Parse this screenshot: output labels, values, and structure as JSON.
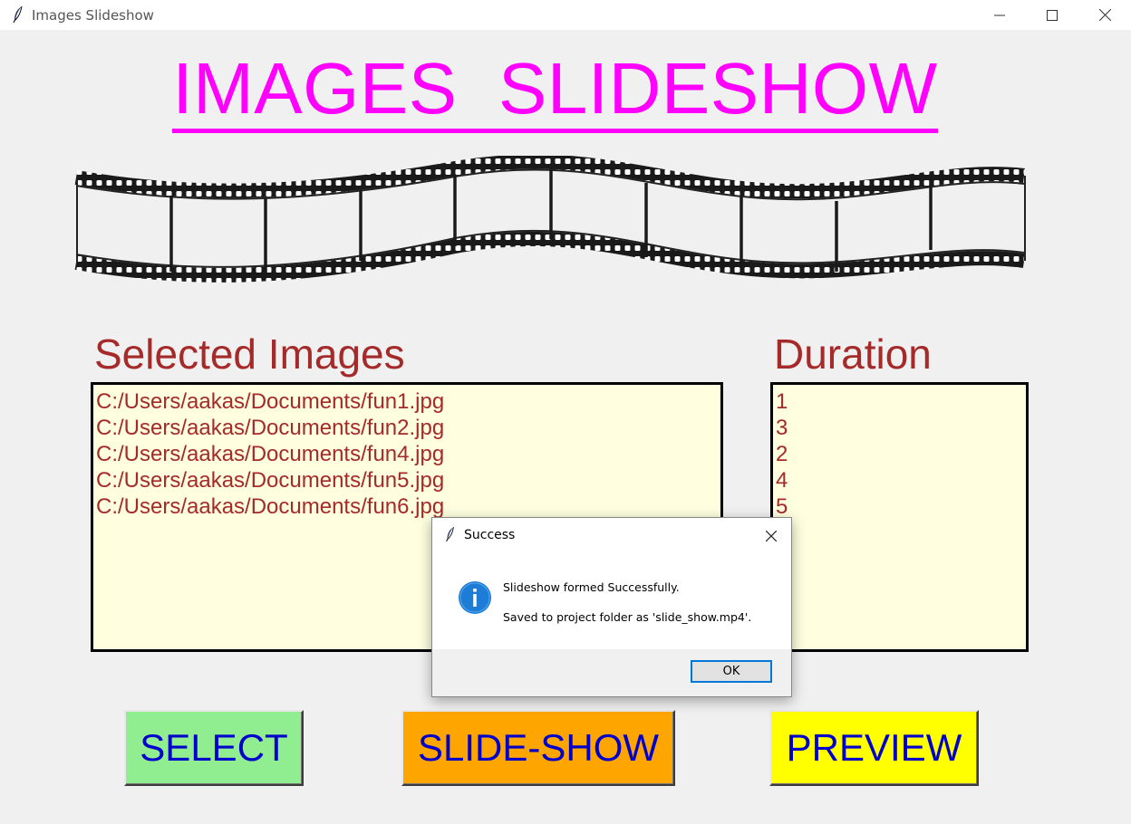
{
  "window": {
    "title": "Images Slideshow",
    "controls": [
      "minimize",
      "maximize",
      "close"
    ]
  },
  "header": {
    "title": "IMAGES  SLIDESHOW",
    "title_color": "#ff00ff"
  },
  "selected_images": {
    "label": "Selected Images",
    "items": [
      "C:/Users/aakas/Documents/fun1.jpg",
      "C:/Users/aakas/Documents/fun2.jpg",
      "C:/Users/aakas/Documents/fun4.jpg",
      "C:/Users/aakas/Documents/fun5.jpg",
      "C:/Users/aakas/Documents/fun6.jpg"
    ]
  },
  "duration": {
    "label": "Duration",
    "items": [
      "1",
      "3",
      "2",
      "4",
      "5"
    ]
  },
  "buttons": {
    "select": "SELECT",
    "slideshow": "SLIDE-SHOW",
    "preview": "PREVIEW"
  },
  "colors": {
    "label_text": "#a52a2a",
    "list_bg": "#ffffe0",
    "button_text": "#0000cd",
    "select_bg": "#90ee90",
    "slideshow_bg": "#ffa500",
    "preview_bg": "#ffff00"
  },
  "dialog": {
    "title": "Success",
    "icon": "info-icon",
    "message_line1": "Slideshow formed Successfully.",
    "message_line2": "Saved to project folder as 'slide_show.mp4'.",
    "ok_label": "OK"
  }
}
